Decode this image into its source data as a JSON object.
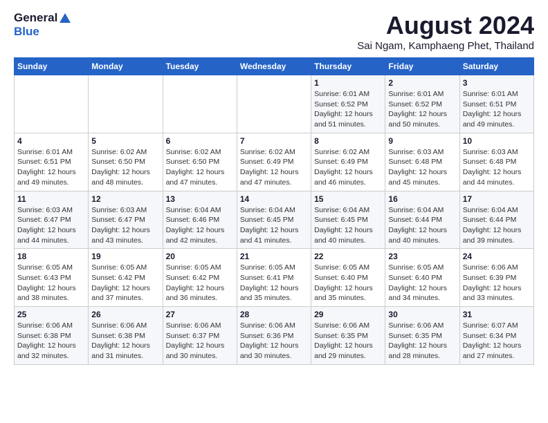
{
  "header": {
    "logo_line1": "General",
    "logo_line2": "Blue",
    "main_title": "August 2024",
    "subtitle": "Sai Ngam, Kamphaeng Phet, Thailand"
  },
  "calendar": {
    "days_of_week": [
      "Sunday",
      "Monday",
      "Tuesday",
      "Wednesday",
      "Thursday",
      "Friday",
      "Saturday"
    ],
    "weeks": [
      [
        {
          "day": "",
          "info": ""
        },
        {
          "day": "",
          "info": ""
        },
        {
          "day": "",
          "info": ""
        },
        {
          "day": "",
          "info": ""
        },
        {
          "day": "1",
          "info": "Sunrise: 6:01 AM\nSunset: 6:52 PM\nDaylight: 12 hours\nand 51 minutes."
        },
        {
          "day": "2",
          "info": "Sunrise: 6:01 AM\nSunset: 6:52 PM\nDaylight: 12 hours\nand 50 minutes."
        },
        {
          "day": "3",
          "info": "Sunrise: 6:01 AM\nSunset: 6:51 PM\nDaylight: 12 hours\nand 49 minutes."
        }
      ],
      [
        {
          "day": "4",
          "info": "Sunrise: 6:01 AM\nSunset: 6:51 PM\nDaylight: 12 hours\nand 49 minutes."
        },
        {
          "day": "5",
          "info": "Sunrise: 6:02 AM\nSunset: 6:50 PM\nDaylight: 12 hours\nand 48 minutes."
        },
        {
          "day": "6",
          "info": "Sunrise: 6:02 AM\nSunset: 6:50 PM\nDaylight: 12 hours\nand 47 minutes."
        },
        {
          "day": "7",
          "info": "Sunrise: 6:02 AM\nSunset: 6:49 PM\nDaylight: 12 hours\nand 47 minutes."
        },
        {
          "day": "8",
          "info": "Sunrise: 6:02 AM\nSunset: 6:49 PM\nDaylight: 12 hours\nand 46 minutes."
        },
        {
          "day": "9",
          "info": "Sunrise: 6:03 AM\nSunset: 6:48 PM\nDaylight: 12 hours\nand 45 minutes."
        },
        {
          "day": "10",
          "info": "Sunrise: 6:03 AM\nSunset: 6:48 PM\nDaylight: 12 hours\nand 44 minutes."
        }
      ],
      [
        {
          "day": "11",
          "info": "Sunrise: 6:03 AM\nSunset: 6:47 PM\nDaylight: 12 hours\nand 44 minutes."
        },
        {
          "day": "12",
          "info": "Sunrise: 6:03 AM\nSunset: 6:47 PM\nDaylight: 12 hours\nand 43 minutes."
        },
        {
          "day": "13",
          "info": "Sunrise: 6:04 AM\nSunset: 6:46 PM\nDaylight: 12 hours\nand 42 minutes."
        },
        {
          "day": "14",
          "info": "Sunrise: 6:04 AM\nSunset: 6:45 PM\nDaylight: 12 hours\nand 41 minutes."
        },
        {
          "day": "15",
          "info": "Sunrise: 6:04 AM\nSunset: 6:45 PM\nDaylight: 12 hours\nand 40 minutes."
        },
        {
          "day": "16",
          "info": "Sunrise: 6:04 AM\nSunset: 6:44 PM\nDaylight: 12 hours\nand 40 minutes."
        },
        {
          "day": "17",
          "info": "Sunrise: 6:04 AM\nSunset: 6:44 PM\nDaylight: 12 hours\nand 39 minutes."
        }
      ],
      [
        {
          "day": "18",
          "info": "Sunrise: 6:05 AM\nSunset: 6:43 PM\nDaylight: 12 hours\nand 38 minutes."
        },
        {
          "day": "19",
          "info": "Sunrise: 6:05 AM\nSunset: 6:42 PM\nDaylight: 12 hours\nand 37 minutes."
        },
        {
          "day": "20",
          "info": "Sunrise: 6:05 AM\nSunset: 6:42 PM\nDaylight: 12 hours\nand 36 minutes."
        },
        {
          "day": "21",
          "info": "Sunrise: 6:05 AM\nSunset: 6:41 PM\nDaylight: 12 hours\nand 35 minutes."
        },
        {
          "day": "22",
          "info": "Sunrise: 6:05 AM\nSunset: 6:40 PM\nDaylight: 12 hours\nand 35 minutes."
        },
        {
          "day": "23",
          "info": "Sunrise: 6:05 AM\nSunset: 6:40 PM\nDaylight: 12 hours\nand 34 minutes."
        },
        {
          "day": "24",
          "info": "Sunrise: 6:06 AM\nSunset: 6:39 PM\nDaylight: 12 hours\nand 33 minutes."
        }
      ],
      [
        {
          "day": "25",
          "info": "Sunrise: 6:06 AM\nSunset: 6:38 PM\nDaylight: 12 hours\nand 32 minutes."
        },
        {
          "day": "26",
          "info": "Sunrise: 6:06 AM\nSunset: 6:38 PM\nDaylight: 12 hours\nand 31 minutes."
        },
        {
          "day": "27",
          "info": "Sunrise: 6:06 AM\nSunset: 6:37 PM\nDaylight: 12 hours\nand 30 minutes."
        },
        {
          "day": "28",
          "info": "Sunrise: 6:06 AM\nSunset: 6:36 PM\nDaylight: 12 hours\nand 30 minutes."
        },
        {
          "day": "29",
          "info": "Sunrise: 6:06 AM\nSunset: 6:35 PM\nDaylight: 12 hours\nand 29 minutes."
        },
        {
          "day": "30",
          "info": "Sunrise: 6:06 AM\nSunset: 6:35 PM\nDaylight: 12 hours\nand 28 minutes."
        },
        {
          "day": "31",
          "info": "Sunrise: 6:07 AM\nSunset: 6:34 PM\nDaylight: 12 hours\nand 27 minutes."
        }
      ]
    ]
  }
}
